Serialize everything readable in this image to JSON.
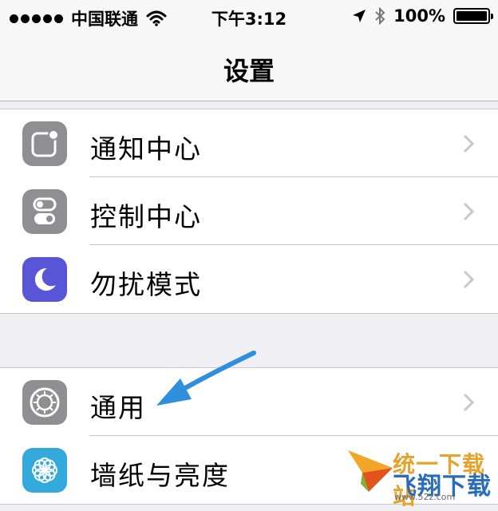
{
  "status_bar": {
    "carrier": "中国联通",
    "time": "下午3:12",
    "battery": "100%",
    "icons": [
      "signal-dots-icon",
      "wifi-icon",
      "location-arrow-icon",
      "bluetooth-icon",
      "battery-icon"
    ]
  },
  "nav": {
    "title": "设置"
  },
  "groups": [
    {
      "items": [
        {
          "label": "通知中心",
          "icon": "notification-center-icon",
          "icon_color": "#8e8e93"
        },
        {
          "label": "控制中心",
          "icon": "control-center-icon",
          "icon_color": "#8e8e93"
        },
        {
          "label": "勿扰模式",
          "icon": "moon-icon",
          "icon_color": "#5856d6"
        }
      ]
    },
    {
      "items": [
        {
          "label": "通用",
          "icon": "gear-icon",
          "icon_color": "#8e8e93"
        },
        {
          "label": "墙纸与亮度",
          "icon": "flower-icon",
          "icon_color": "#34aadc"
        }
      ]
    }
  ],
  "annotation": {
    "icon": "blue-arrow-icon",
    "color": "#2f8fdc"
  },
  "watermark": {
    "line1": "统一下载站",
    "line2": "飞翔下载",
    "url": "www.52z.com"
  }
}
